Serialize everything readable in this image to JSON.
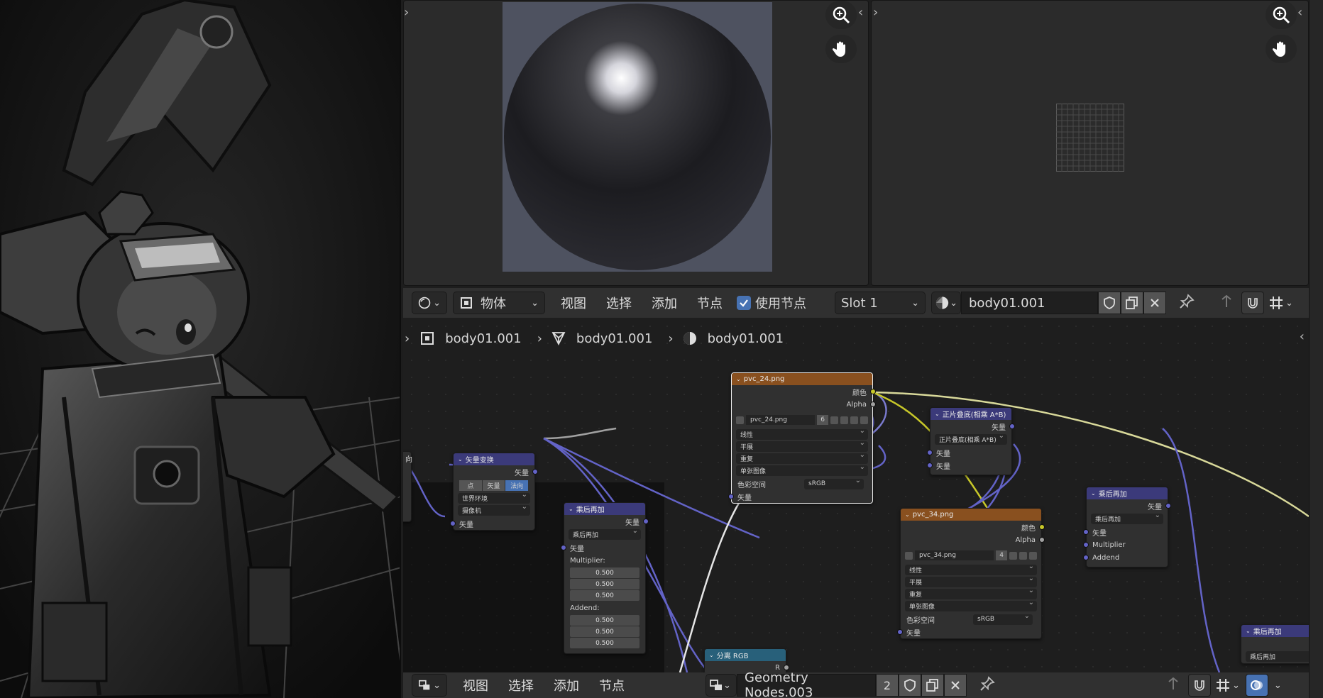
{
  "node_header": {
    "editor_type_icon": "shader-editor-icon",
    "object_label": "物体",
    "menus": [
      "视图",
      "选择",
      "添加",
      "节点"
    ],
    "use_nodes_label": "使用节点",
    "slot_label": "Slot 1",
    "material_name": "body01.001"
  },
  "breadcrumb": {
    "items": [
      "body01.001",
      "body01.001",
      "body01.001"
    ]
  },
  "nodes": {
    "tex1": {
      "title": "pvc_24.png",
      "out_color": "颜色",
      "out_alpha": "Alpha",
      "image": "pvc_24.png",
      "users": "6",
      "interp": "线性",
      "proj": "平展",
      "ext": "重复",
      "source": "单张图像",
      "colorspace_label": "色彩空间",
      "colorspace": "sRGB",
      "in_vector": "矢量"
    },
    "mix1": {
      "title": "正片叠底(相乘 A*B)",
      "out": "矢量",
      "op": "正片叠底(相乘 A*B)",
      "in1": "矢量",
      "in2": "矢量"
    },
    "tex2": {
      "title": "pvc_34.png",
      "out_color": "颜色",
      "out_alpha": "Alpha",
      "image": "pvc_34.png",
      "users": "4",
      "interp": "线性",
      "proj": "平展",
      "ext": "重复",
      "source": "单张图像",
      "colorspace_label": "色彩空间",
      "colorspace": "sRGB",
      "in_vector": "矢量"
    },
    "muladd1": {
      "title": "乘后再加",
      "out": "矢量",
      "op": "乘后再加",
      "in_vector": "矢量",
      "in_mult": "Multiplier",
      "in_add": "Addend"
    },
    "muladd2": {
      "title": "乘后再加",
      "out": "矢量",
      "op": "乘后再加",
      "in_vector": "矢量",
      "mult_label": "Multiplier:",
      "mult_vals": [
        "0.500",
        "0.500",
        "0.500"
      ],
      "add_label": "Addend:",
      "add_vals": [
        "0.500",
        "0.500",
        "0.500"
      ]
    },
    "vtrans": {
      "title": "矢量变换",
      "out": "矢量",
      "tabs": [
        "点",
        "矢量",
        "法向"
      ],
      "from": "世界环境",
      "to": "摄像机",
      "in": "矢量"
    },
    "sep": {
      "title": "分离 RGB",
      "out_r": "R"
    },
    "muladd3": {
      "title": "乘后再加",
      "op": "乘后再加"
    },
    "partial_left": {
      "label": "向"
    }
  },
  "bottom_header": {
    "menus": [
      "视图",
      "选择",
      "添加",
      "节点"
    ],
    "nodetree_name": "Geometry Nodes.003",
    "users": "2"
  },
  "colors": {
    "texture_header": "#89501f",
    "vector_header": "#3b3a7a",
    "converter_header": "#28607a",
    "accent": "#4772b3",
    "link_yellow": "#c7c729",
    "link_purple": "#6363c7"
  }
}
